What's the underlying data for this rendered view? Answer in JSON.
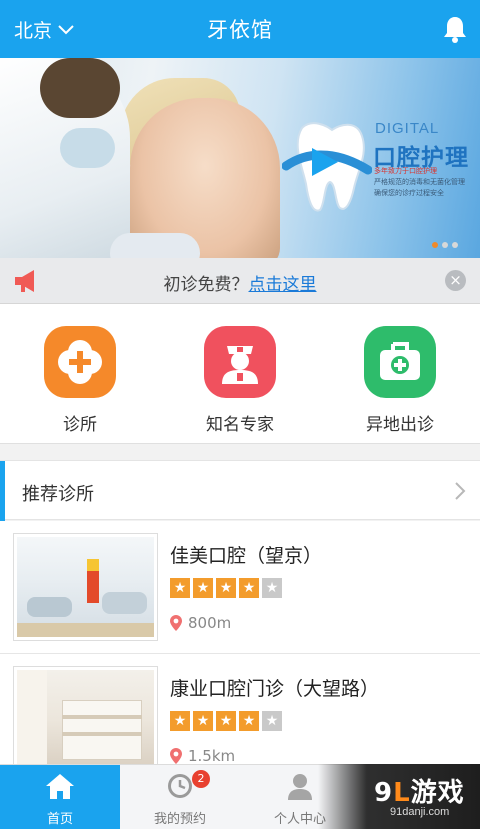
{
  "header": {
    "city": "北京",
    "title": "牙依馆"
  },
  "banner": {
    "brand_en": "DIGITAL",
    "brand_cn": "口腔护理",
    "sub_red": "多年致力于口腔护理",
    "sub_lines": "严格规范的消毒和无菌化管理 确保您的诊疗过程安全",
    "colors": {
      "accent": "#1aa3ee",
      "dot_active": "#f08a2a"
    }
  },
  "notice": {
    "text": "初诊免费？",
    "link": "点击这里",
    "close": "×"
  },
  "quick": [
    {
      "label": "诊所",
      "icon": "clinic-cross-icon",
      "color": "#f5892a"
    },
    {
      "label": "知名专家",
      "icon": "doctor-icon",
      "color": "#f0515e"
    },
    {
      "label": "异地出诊",
      "icon": "medical-kit-icon",
      "color": "#2ebc6b"
    }
  ],
  "section": {
    "title": "推荐诊所"
  },
  "clinics": [
    {
      "name": "佳美口腔（望京）",
      "rating": 4,
      "max": 5,
      "distance": "800m"
    },
    {
      "name": "康业口腔门诊（大望路）",
      "rating": 4,
      "max": 5,
      "distance": "1.5km"
    }
  ],
  "tabs": [
    {
      "label": "首页",
      "icon": "home-icon",
      "active": true
    },
    {
      "label": "我的预约",
      "icon": "clock-icon",
      "badge": "2"
    },
    {
      "label": "个人中心",
      "icon": "user-icon"
    }
  ],
  "watermark": {
    "main_a": "9",
    "main_b": "L",
    "main_c": "游戏",
    "site": "91danji.com"
  }
}
